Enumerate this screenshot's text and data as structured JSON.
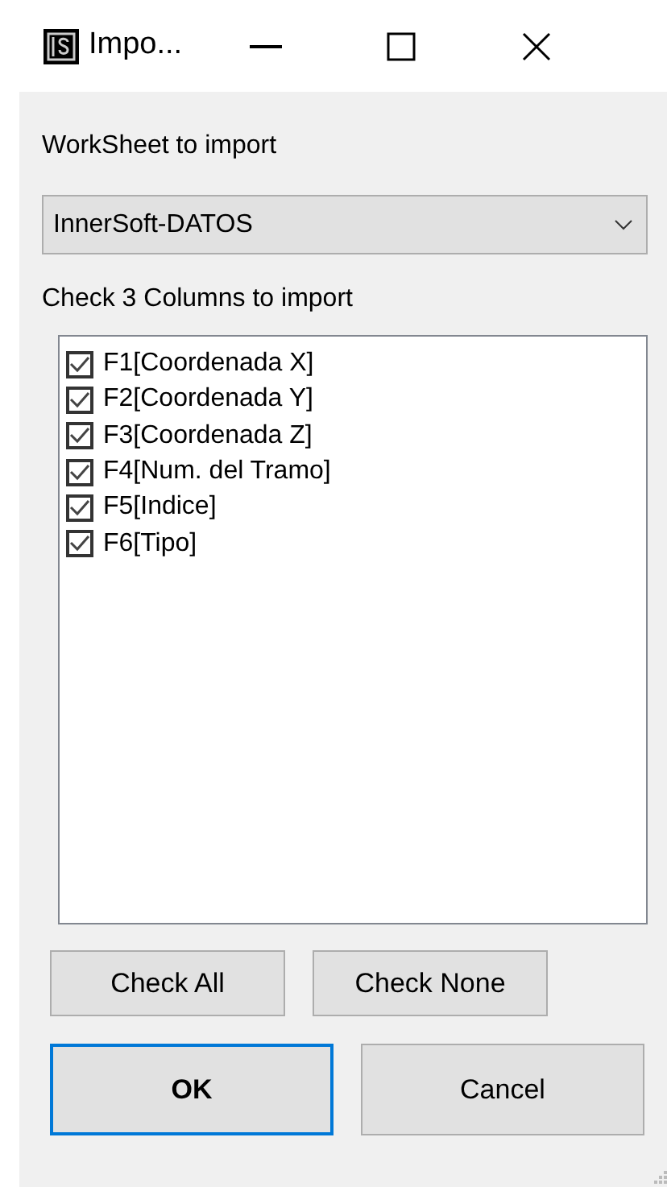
{
  "window": {
    "title": "Impo..."
  },
  "worksheet_label": "WorkSheet to import",
  "worksheet_select": {
    "value": "InnerSoft-DATOS"
  },
  "columns_label": "Check 3 Columns to import",
  "columns": [
    {
      "label": "F1[Coordenada X]",
      "checked": true
    },
    {
      "label": "F2[Coordenada Y]",
      "checked": true
    },
    {
      "label": "F3[Coordenada Z]",
      "checked": true
    },
    {
      "label": "F4[Num. del Tramo]",
      "checked": true
    },
    {
      "label": "F5[Indice]",
      "checked": true
    },
    {
      "label": "F6[Tipo]",
      "checked": true
    }
  ],
  "check_buttons": [
    "Check All",
    "Check None"
  ],
  "dialog_buttons": [
    {
      "label": "OK",
      "focused": true
    },
    {
      "label": "Cancel",
      "focused": false
    }
  ]
}
